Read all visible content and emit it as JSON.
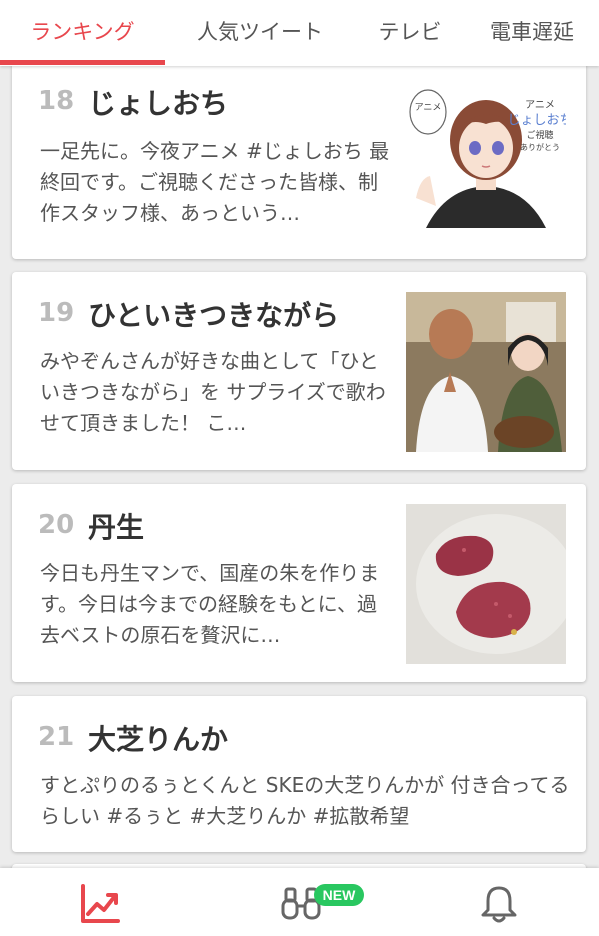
{
  "tabs": [
    {
      "label": "ランキング",
      "active": true
    },
    {
      "label": "人気ツイート",
      "active": false
    },
    {
      "label": "テレビ",
      "active": false
    },
    {
      "label": "電車遅延",
      "active": false
    }
  ],
  "accent_color": "#e8474d",
  "cards": [
    {
      "rank": "18",
      "title": "じょしおち",
      "text": "一足先に。今夜アニメ #じょしおち 最終回です。ご視聴くださった皆様、制作スタッフ様、あっという…",
      "thumb_icon": "anime-illustration-thumbnail",
      "thumb_caption": "アニメ じょしおち ご視聴 ありがとう"
    },
    {
      "rank": "19",
      "title": "ひといきつきながら",
      "text": "みやぞんさんが好きな曲として「ひといきつきながら」を サプライズで歌わせて頂きました！ こ…",
      "thumb_icon": "photo-two-people-thumbnail"
    },
    {
      "rank": "20",
      "title": "丹生",
      "text": "今日も丹生マンで、国産の朱を作ります。今日は今までの経験をもとに、過去ベストの原石を贅沢に…",
      "thumb_icon": "red-stones-photo-thumbnail"
    },
    {
      "rank": "21",
      "title": "大芝りんか",
      "text": "すとぷりのるぅとくんと SKEの大芝りんかが 付き合ってるらしい #るぅと #大芝りんか #拡散希望"
    }
  ],
  "bottom_nav": {
    "items": [
      {
        "icon": "trending-chart-icon",
        "active": true
      },
      {
        "icon": "binoculars-icon",
        "active": false,
        "badge": "NEW"
      },
      {
        "icon": "bell-icon",
        "active": false
      }
    ]
  }
}
